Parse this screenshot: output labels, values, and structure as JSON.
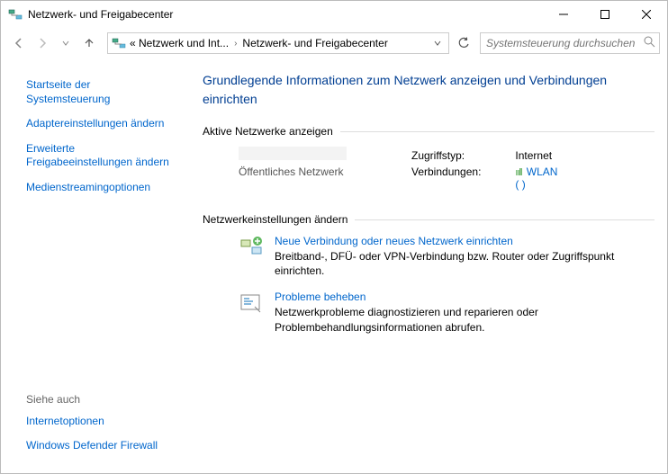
{
  "window": {
    "title": "Netzwerk- und Freigabecenter"
  },
  "breadcrumb": {
    "part1": "« Netzwerk und Int...",
    "part2": "Netzwerk- und Freigabecenter"
  },
  "search": {
    "placeholder": "Systemsteuerung durchsuchen"
  },
  "sidebar": {
    "home": "Startseite der Systemsteuerung",
    "adapter": "Adaptereinstellungen ändern",
    "sharing": "Erweiterte Freigabeeinstellungen ändern",
    "streaming": "Medienstreamingoptionen",
    "seealso_label": "Siehe auch",
    "inetopts": "Internetoptionen",
    "firewall": "Windows Defender Firewall"
  },
  "main": {
    "heading": "Grundlegende Informationen zum Netzwerk anzeigen und Verbindungen einrichten",
    "active_label": "Aktive Netzwerke anzeigen",
    "net_type": "Öffentliches Netzwerk",
    "access_label": "Zugriffstyp:",
    "access_value": "Internet",
    "conn_label": "Verbindungen:",
    "conn_value": "WLAN",
    "conn_detail": "(                       )",
    "change_label": "Netzwerkeinstellungen ändern",
    "opt1": {
      "title": "Neue Verbindung oder neues Netzwerk einrichten",
      "desc": "Breitband-, DFÜ- oder VPN-Verbindung bzw. Router oder Zugriffspunkt einrichten."
    },
    "opt2": {
      "title": "Probleme beheben",
      "desc": "Netzwerkprobleme diagnostizieren und reparieren oder Problembehandlungsinformationen abrufen."
    }
  }
}
